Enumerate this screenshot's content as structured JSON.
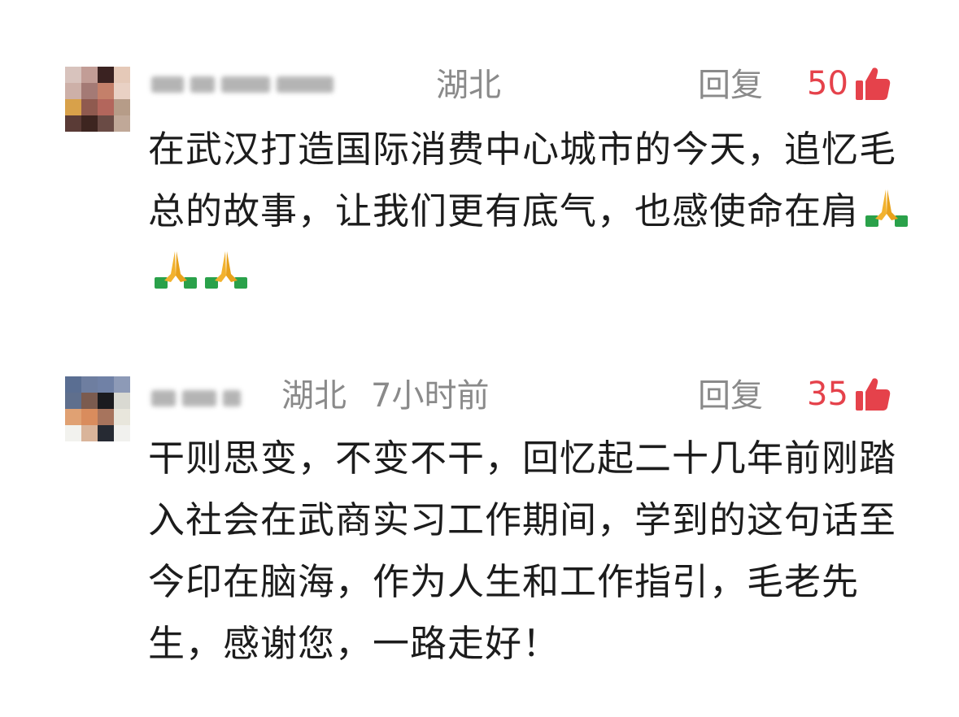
{
  "comments": [
    {
      "region": "湖北",
      "time": "",
      "reply_label": "回复",
      "likes": "50",
      "content": "在武汉打造国际消费中心城市的今天，追忆毛总的故事，让我们更有底气，也感使命在肩",
      "emoji": "folded-hands",
      "emoji_count": 3
    },
    {
      "region": "湖北",
      "time": "7小时前",
      "reply_label": "回复",
      "likes": "35",
      "content": "干则思变，不变不干，回忆起二十几年前刚踏入社会在武商实习工作期间，学到的这句话至今印在脑海，作为人生和工作指引，毛老先生，感谢您，一路走好！"
    }
  ],
  "colors": {
    "meta": "#8a8a8a",
    "like_accent": "#e5424b",
    "text": "#1c1c1c"
  }
}
